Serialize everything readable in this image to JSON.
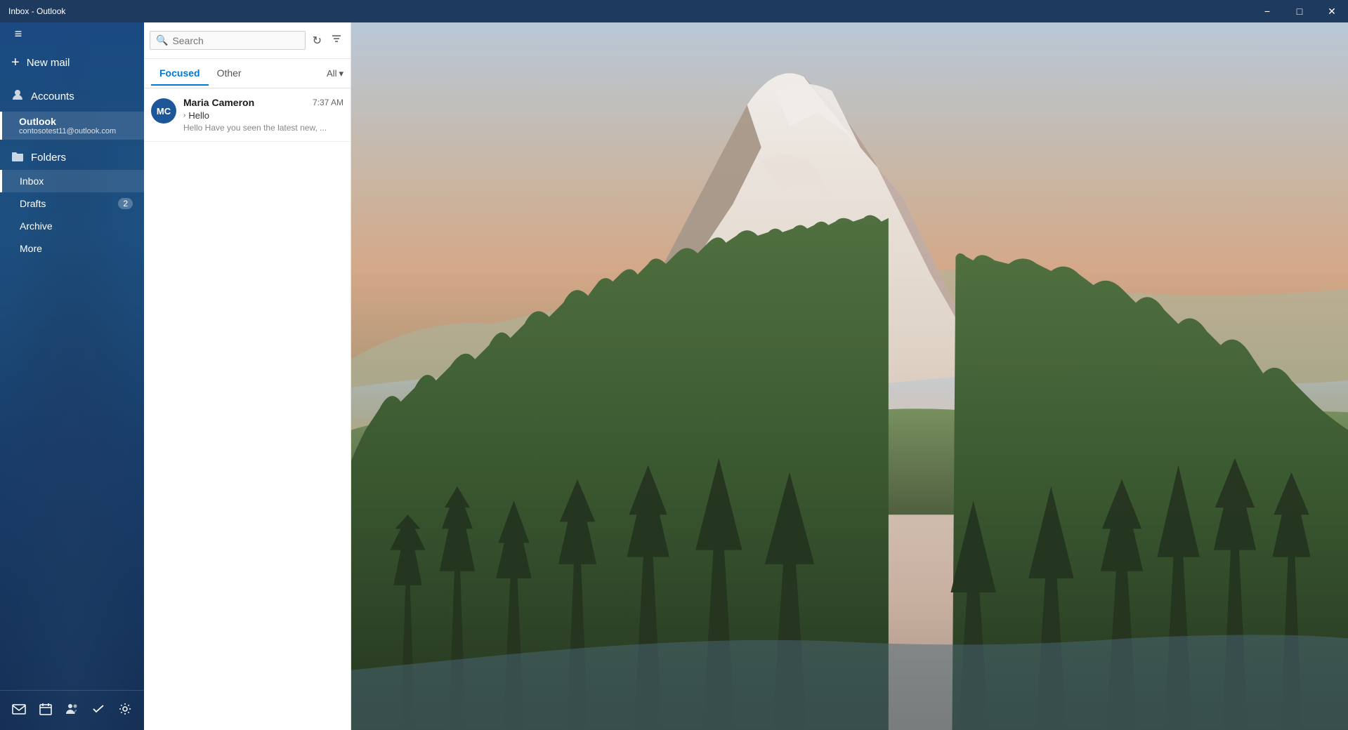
{
  "titleBar": {
    "title": "Inbox - Outlook",
    "minimizeLabel": "−",
    "maximizeLabel": "□",
    "closeLabel": "✕"
  },
  "sidebar": {
    "hamburgerIcon": "≡",
    "newMail": {
      "label": "New mail",
      "icon": "+"
    },
    "accounts": {
      "label": "Accounts",
      "icon": "👤"
    },
    "accountItem": {
      "name": "Outlook",
      "email": "contosotest11@outlook.com"
    },
    "folders": {
      "label": "Folders",
      "icon": "📁"
    },
    "folderItems": [
      {
        "name": "Inbox",
        "badge": null,
        "active": true
      },
      {
        "name": "Drafts",
        "badge": "2",
        "active": false
      },
      {
        "name": "Archive",
        "badge": null,
        "active": false
      },
      {
        "name": "More",
        "badge": null,
        "active": false
      }
    ],
    "footer": {
      "mailIcon": "✉",
      "calendarIcon": "⊞",
      "peopleIcon": "👥",
      "todoIcon": "✓",
      "settingsIcon": "⚙"
    }
  },
  "emailList": {
    "search": {
      "placeholder": "Search",
      "value": ""
    },
    "refreshIcon": "↻",
    "filterIcon": "☰",
    "tabs": [
      {
        "label": "Focused",
        "active": true
      },
      {
        "label": "Other",
        "active": false
      }
    ],
    "filterLabel": "All",
    "emails": [
      {
        "avatarInitials": "MC",
        "avatarBg": "#1e5799",
        "sender": "Maria Cameron",
        "time": "7:37 AM",
        "subject": "Hello",
        "preview": "Hello Have you seen the latest new, ..."
      }
    ]
  }
}
